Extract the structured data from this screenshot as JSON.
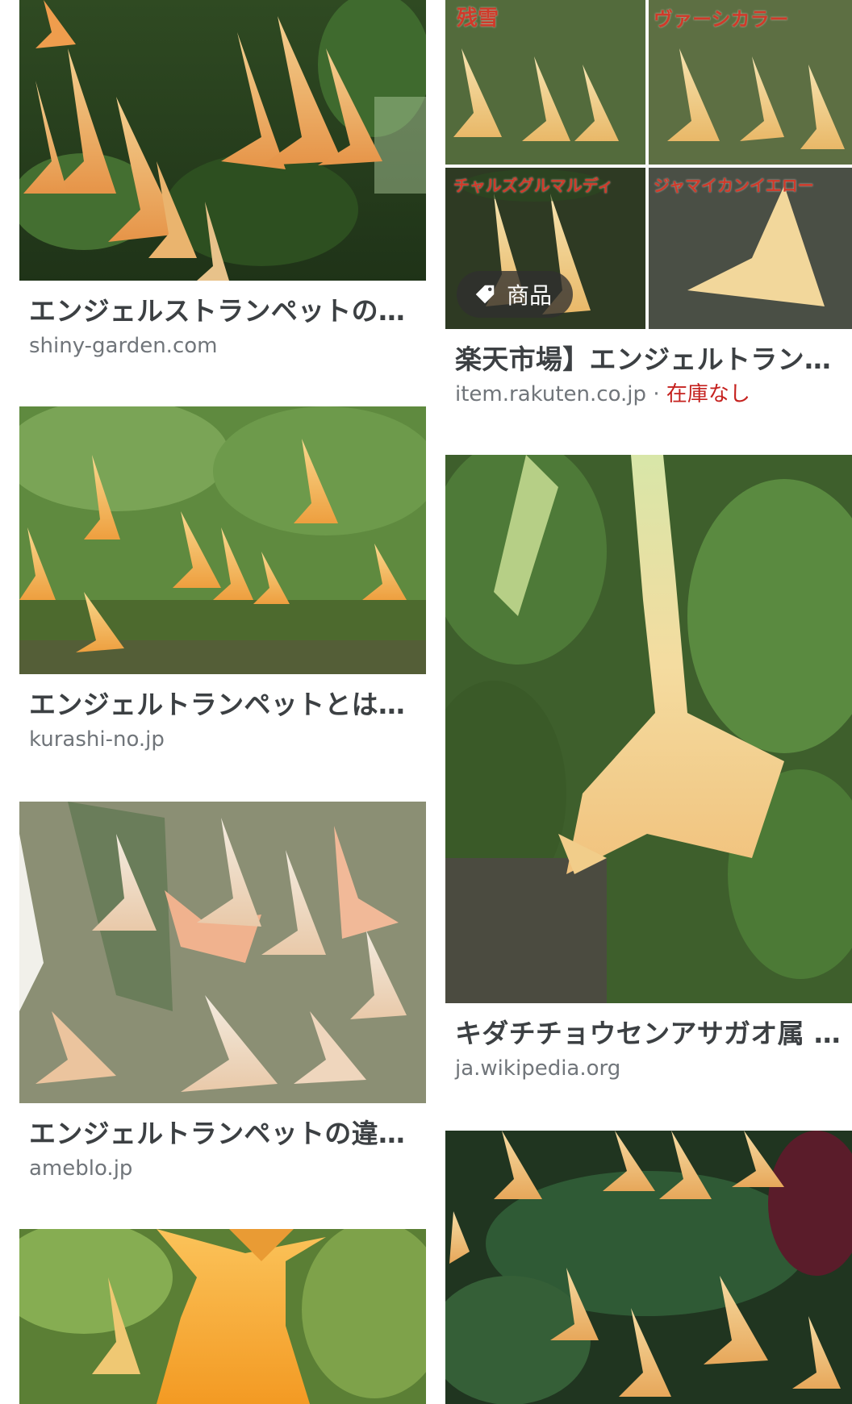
{
  "results": [
    {
      "title": "エンジェルストランペットの…",
      "source": "shiny-garden.com"
    },
    {
      "title": "楽天市場】エンジェルトラン…",
      "source": "item.rakuten.co.jp",
      "separator": "·",
      "stock": "在庫なし",
      "badge": "商品",
      "image_labels": [
        "残雪",
        "ヴァーシカラー",
        "チャルズグルマルディ",
        "ジャマイカンイエロー"
      ]
    },
    {
      "title": "エンジェルトランペットとは…",
      "source": "kurashi-no.jp"
    },
    {
      "title": "キダチチョウセンアサガオ属 -…",
      "source": "ja.wikipedia.org"
    },
    {
      "title": "エンジェルトランペットの違…",
      "source": "ameblo.jp"
    },
    {
      "title": "",
      "source": ""
    },
    {
      "title": "",
      "source": ""
    }
  ]
}
